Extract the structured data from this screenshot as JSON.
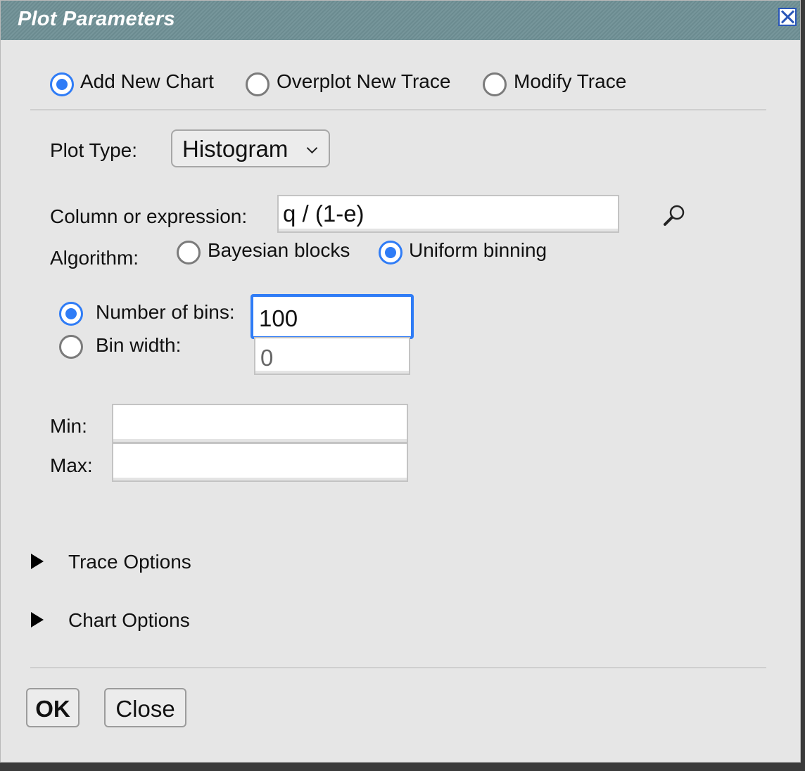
{
  "dialog": {
    "title": "Plot Parameters",
    "close_icon": "close-icon"
  },
  "mode": {
    "options": [
      {
        "label": "Add New Chart",
        "selected": true
      },
      {
        "label": "Overplot New Trace",
        "selected": false
      },
      {
        "label": "Modify Trace",
        "selected": false
      }
    ]
  },
  "plot_type": {
    "label": "Plot Type:",
    "value": "Histogram"
  },
  "expression": {
    "label": "Column or expression:",
    "value": "q / (1-e)",
    "search_icon": "magnifier-icon"
  },
  "algorithm": {
    "label": "Algorithm:",
    "options": [
      {
        "label": "Bayesian blocks",
        "selected": false
      },
      {
        "label": "Uniform binning",
        "selected": true
      }
    ]
  },
  "binning": {
    "num_bins_label": "Number of bins:",
    "num_bins_value": "100",
    "num_bins_selected": true,
    "bin_width_label": "Bin width:",
    "bin_width_value": "0",
    "bin_width_selected": false
  },
  "range": {
    "min_label": "Min:",
    "min_value": "",
    "max_label": "Max:",
    "max_value": ""
  },
  "sections": {
    "trace_options": "Trace Options",
    "chart_options": "Chart Options"
  },
  "buttons": {
    "ok": "OK",
    "close": "Close"
  },
  "colors": {
    "titlebar": "#6e8f95",
    "accent": "#2f7cf6",
    "background": "#e6e6e6"
  }
}
